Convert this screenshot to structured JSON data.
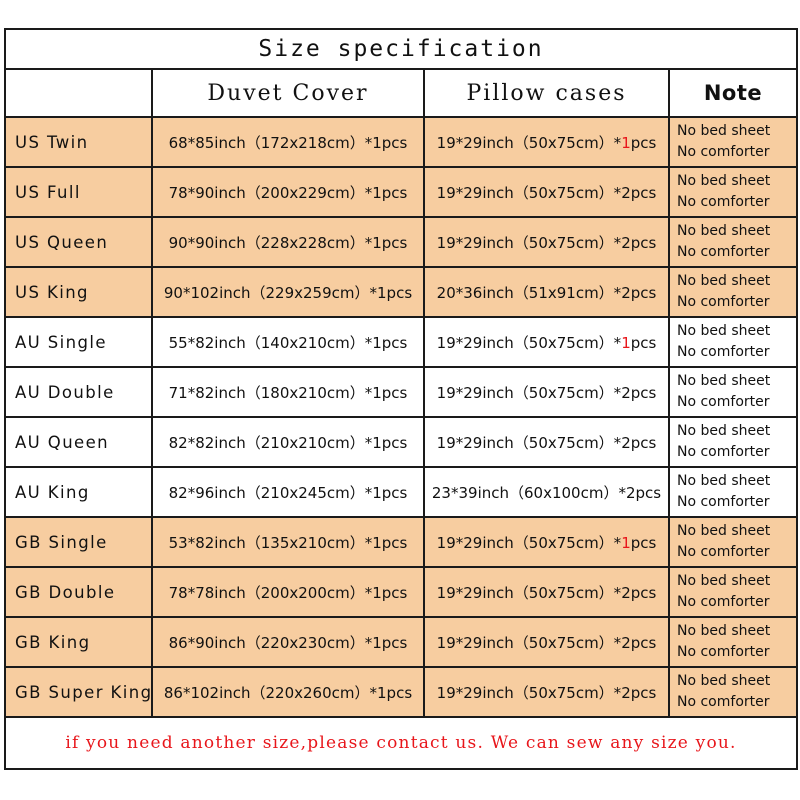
{
  "table": {
    "title": "Size specification",
    "headers": {
      "label": "",
      "duvet": "Duvet Cover",
      "pillow": "Pillow cases",
      "note": "Note"
    },
    "note_line1": "No bed sheet",
    "note_line2": "No comforter",
    "rows": [
      {
        "label": "US Twin",
        "duvet": "68*85inch（172x218cm）*1pcs",
        "pillow_pre": "19*29inch（50x75cm）*",
        "pillow_qty": "1",
        "pillow_post": "pcs",
        "pillow_qty_red": true,
        "shade": "peach"
      },
      {
        "label": "US Full",
        "duvet": "78*90inch（200x229cm）*1pcs",
        "pillow_pre": "19*29inch（50x75cm）*",
        "pillow_qty": "2",
        "pillow_post": "pcs",
        "pillow_qty_red": false,
        "shade": "peach"
      },
      {
        "label": "US Queen",
        "duvet": "90*90inch（228x228cm）*1pcs",
        "pillow_pre": "19*29inch（50x75cm）*",
        "pillow_qty": "2",
        "pillow_post": "pcs",
        "pillow_qty_red": false,
        "shade": "peach"
      },
      {
        "label": "US King",
        "duvet": "90*102inch（229x259cm）*1pcs",
        "pillow_pre": "20*36inch（51x91cm）*",
        "pillow_qty": "2",
        "pillow_post": "pcs",
        "pillow_qty_red": false,
        "shade": "peach"
      },
      {
        "label": "AU Single",
        "duvet": "55*82inch（140x210cm）*1pcs",
        "pillow_pre": "19*29inch（50x75cm）*",
        "pillow_qty": "1",
        "pillow_post": "pcs",
        "pillow_qty_red": true,
        "shade": "white"
      },
      {
        "label": "AU Double",
        "duvet": "71*82inch（180x210cm）*1pcs",
        "pillow_pre": "19*29inch（50x75cm）*",
        "pillow_qty": "2",
        "pillow_post": "pcs",
        "pillow_qty_red": false,
        "shade": "white"
      },
      {
        "label": "AU Queen",
        "duvet": "82*82inch（210x210cm）*1pcs",
        "pillow_pre": "19*29inch（50x75cm）*",
        "pillow_qty": "2",
        "pillow_post": "pcs",
        "pillow_qty_red": false,
        "shade": "white"
      },
      {
        "label": "AU King",
        "duvet": "82*96inch（210x245cm）*1pcs",
        "pillow_pre": "23*39inch（60x100cm）*",
        "pillow_qty": "2",
        "pillow_post": "pcs",
        "pillow_qty_red": false,
        "shade": "white"
      },
      {
        "label": "GB Single",
        "duvet": "53*82inch（135x210cm）*1pcs",
        "pillow_pre": "19*29inch（50x75cm）*",
        "pillow_qty": "1",
        "pillow_post": "pcs",
        "pillow_qty_red": true,
        "shade": "peach"
      },
      {
        "label": "GB Double",
        "duvet": "78*78inch（200x200cm）*1pcs",
        "pillow_pre": "19*29inch（50x75cm）*",
        "pillow_qty": "2",
        "pillow_post": "pcs",
        "pillow_qty_red": false,
        "shade": "peach"
      },
      {
        "label": "GB King",
        "duvet": "86*90inch（220x230cm）*1pcs",
        "pillow_pre": "19*29inch（50x75cm）*",
        "pillow_qty": "2",
        "pillow_post": "pcs",
        "pillow_qty_red": false,
        "shade": "peach"
      },
      {
        "label": "GB Super King",
        "duvet": "86*102inch（220x260cm）*1pcs",
        "pillow_pre": "19*29inch（50x75cm）*",
        "pillow_qty": "2",
        "pillow_post": "pcs",
        "pillow_qty_red": false,
        "shade": "peach"
      }
    ],
    "footer": "if you need another size,please contact us. We can sew any size you."
  },
  "colors": {
    "peach_row": "#f7cda0",
    "white_row": "#ffffff",
    "border": "#1a1a1a",
    "accent_red": "#e8161b",
    "text": "#111111"
  }
}
